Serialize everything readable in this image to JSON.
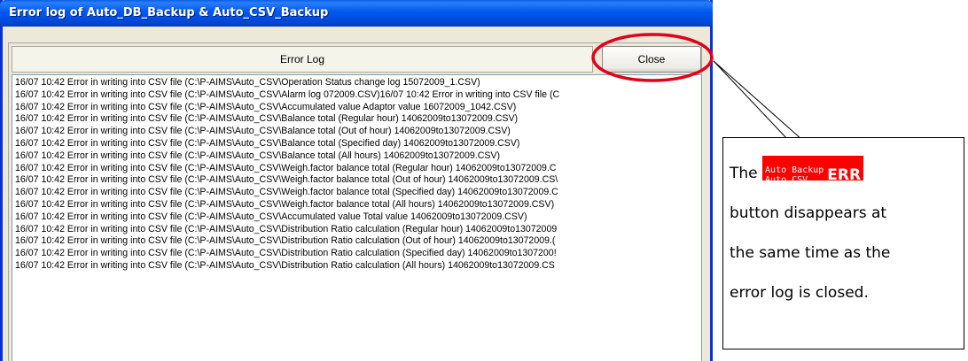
{
  "window": {
    "title": "Error log of Auto_DB_Backup & Auto_CSV_Backup"
  },
  "header": {
    "column_label": "Error Log",
    "close_label": "Close"
  },
  "log_lines": [
    "16/07 10:42 Error in writing into CSV file (C:\\P-AIMS\\Auto_CSV\\Operation Status change log 15072009_1.CSV)",
    "16/07 10:42 Error in writing into CSV file (C:\\P-AIMS\\Auto_CSV\\Alarm log 072009.CSV)16/07 10:42 Error in writing into CSV file (C",
    "16/07 10:42 Error in writing into CSV file (C:\\P-AIMS\\Auto_CSV\\Accumulated value Adaptor value 16072009_1042.CSV)",
    "16/07 10:42 Error in writing into CSV file (C:\\P-AIMS\\Auto_CSV\\Balance total (Regular hour) 14062009to13072009.CSV)",
    "16/07 10:42 Error in writing into CSV file (C:\\P-AIMS\\Auto_CSV\\Balance total (Out of hour) 14062009to13072009.CSV)",
    "16/07 10:42 Error in writing into CSV file (C:\\P-AIMS\\Auto_CSV\\Balance total (Specified day) 14062009to13072009.CSV)",
    "16/07 10:42 Error in writing into CSV file (C:\\P-AIMS\\Auto_CSV\\Balance total (All hours) 14062009to13072009.CSV)",
    "16/07 10:42 Error in writing into CSV file (C:\\P-AIMS\\Auto_CSV\\Weigh.factor balance total (Regular hour) 14062009to13072009.C",
    "16/07 10:42 Error in writing into CSV file (C:\\P-AIMS\\Auto_CSV\\Weigh.factor balance total (Out of hour) 14062009to13072009.CS\\",
    "16/07 10:42 Error in writing into CSV file (C:\\P-AIMS\\Auto_CSV\\Weigh.factor balance total (Specified day) 14062009to13072009.C",
    "16/07 10:42 Error in writing into CSV file (C:\\P-AIMS\\Auto_CSV\\Weigh.factor balance total (All hours) 14062009to13072009.CSV)",
    "16/07 10:42 Error in writing into CSV file (C:\\P-AIMS\\Auto_CSV\\Accumulated value Total value 14062009to13072009.CSV)",
    "16/07 10:42 Error in writing into CSV file (C:\\P-AIMS\\Auto_CSV\\Distribution Ratio calculation (Regular hour) 14062009to13072009",
    "16/07 10:42 Error in writing into CSV file (C:\\P-AIMS\\Auto_CSV\\Distribution Ratio calculation (Out of hour) 14062009to13072009.(",
    "16/07 10:42 Error in writing into CSV file (C:\\P-AIMS\\Auto_CSV\\Distribution Ratio calculation (Specified day) 14062009to1307200!",
    "16/07 10:42 Error in writing into CSV file (C:\\P-AIMS\\Auto_CSV\\Distribution Ratio calculation (All hours) 14062009to13072009.CS"
  ],
  "callout": {
    "prefix": "The",
    "badge_line1": "Auto Backup",
    "badge_line2": "Auto CSV",
    "badge_err": "ERR",
    "line2": "button disappears at",
    "line3": "the same time as the",
    "line4": "error log is closed."
  },
  "colors": {
    "title_bar": "#0058ee",
    "highlight_ring": "#e0001b",
    "err_badge": "#ff0000"
  }
}
